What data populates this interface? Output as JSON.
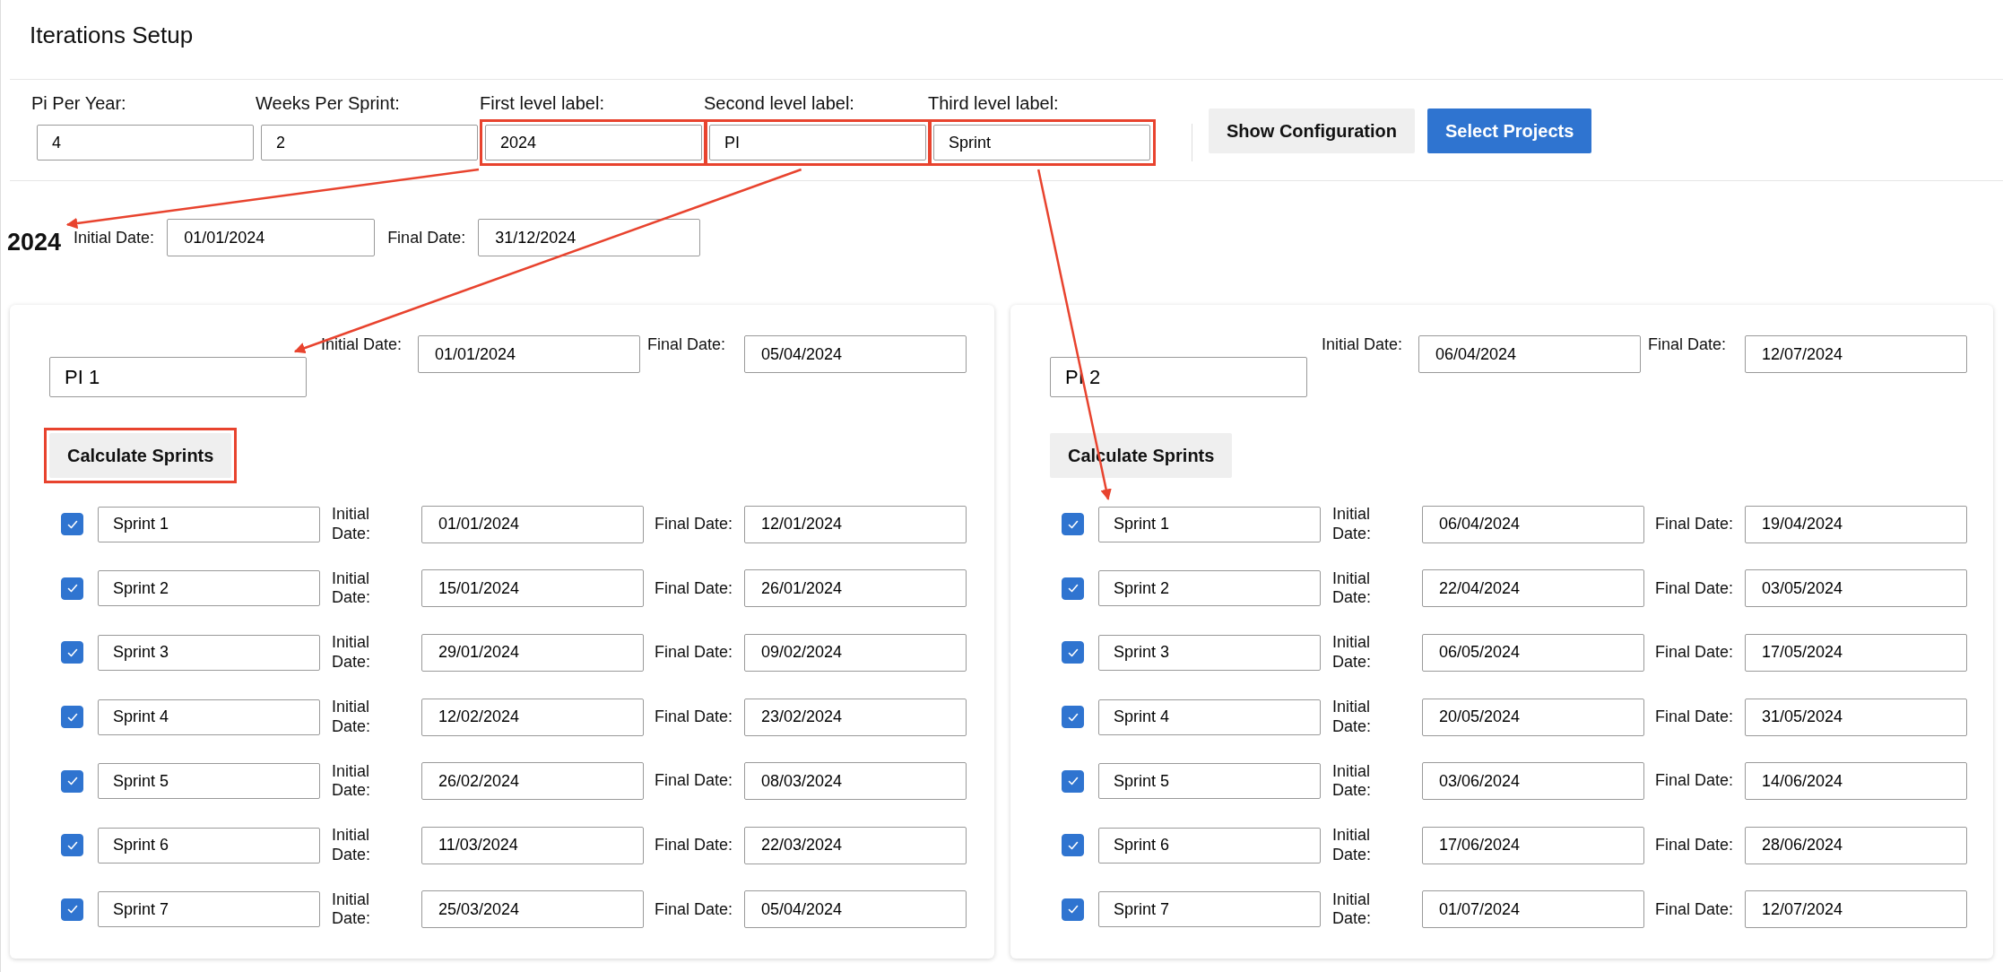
{
  "title": "Iterations Setup",
  "settings": [
    {
      "label": "Pi Per Year:",
      "value": "4",
      "highlighted": false
    },
    {
      "label": "Weeks Per Sprint:",
      "value": "2",
      "highlighted": false
    },
    {
      "label": "First level label:",
      "value": "2024",
      "highlighted": true
    },
    {
      "label": "Second level label:",
      "value": "PI",
      "highlighted": true
    },
    {
      "label": "Third level label:",
      "value": "Sprint",
      "highlighted": true
    }
  ],
  "buttons": [
    {
      "label": "Show Configuration",
      "kind": "secondary"
    },
    {
      "label": "Select Projects",
      "kind": "primary"
    }
  ],
  "year": {
    "heading": "2024",
    "initial_label": "Initial Date:",
    "initial_value": "01/01/2024",
    "final_label": "Final Date:",
    "final_value": "31/12/2024"
  },
  "pis": [
    {
      "name": "PI 1",
      "initial_label": "Initial Date:",
      "initial_value": "01/01/2024",
      "final_label": "Final Date:",
      "final_value": "05/04/2024",
      "calculate_button": {
        "label": "Calculate Sprints",
        "highlighted": true
      },
      "sprints": [
        {
          "checked": true,
          "name": "Sprint 1",
          "initial_label": "Initial Date:",
          "initial_value": "01/01/2024",
          "final_label": "Final Date:",
          "final_value": "12/01/2024"
        },
        {
          "checked": true,
          "name": "Sprint 2",
          "initial_label": "Initial Date:",
          "initial_value": "15/01/2024",
          "final_label": "Final Date:",
          "final_value": "26/01/2024"
        },
        {
          "checked": true,
          "name": "Sprint 3",
          "initial_label": "Initial Date:",
          "initial_value": "29/01/2024",
          "final_label": "Final Date:",
          "final_value": "09/02/2024"
        },
        {
          "checked": true,
          "name": "Sprint 4",
          "initial_label": "Initial Date:",
          "initial_value": "12/02/2024",
          "final_label": "Final Date:",
          "final_value": "23/02/2024"
        },
        {
          "checked": true,
          "name": "Sprint 5",
          "initial_label": "Initial Date:",
          "initial_value": "26/02/2024",
          "final_label": "Final Date:",
          "final_value": "08/03/2024"
        },
        {
          "checked": true,
          "name": "Sprint 6",
          "initial_label": "Initial Date:",
          "initial_value": "11/03/2024",
          "final_label": "Final Date:",
          "final_value": "22/03/2024"
        },
        {
          "checked": true,
          "name": "Sprint 7",
          "initial_label": "Initial Date:",
          "initial_value": "25/03/2024",
          "final_label": "Final Date:",
          "final_value": "05/04/2024"
        }
      ]
    },
    {
      "name": "PI 2",
      "initial_label": "Initial Date:",
      "initial_value": "06/04/2024",
      "final_label": "Final Date:",
      "final_value": "12/07/2024",
      "calculate_button": {
        "label": "Calculate Sprints",
        "highlighted": false
      },
      "sprints": [
        {
          "checked": true,
          "name": "Sprint 1",
          "initial_label": "Initial Date:",
          "initial_value": "06/04/2024",
          "final_label": "Final Date:",
          "final_value": "19/04/2024"
        },
        {
          "checked": true,
          "name": "Sprint 2",
          "initial_label": "Initial Date:",
          "initial_value": "22/04/2024",
          "final_label": "Final Date:",
          "final_value": "03/05/2024"
        },
        {
          "checked": true,
          "name": "Sprint 3",
          "initial_label": "Initial Date:",
          "initial_value": "06/05/2024",
          "final_label": "Final Date:",
          "final_value": "17/05/2024"
        },
        {
          "checked": true,
          "name": "Sprint 4",
          "initial_label": "Initial Date:",
          "initial_value": "20/05/2024",
          "final_label": "Final Date:",
          "final_value": "31/05/2024"
        },
        {
          "checked": true,
          "name": "Sprint 5",
          "initial_label": "Initial Date:",
          "initial_value": "03/06/2024",
          "final_label": "Final Date:",
          "final_value": "14/06/2024"
        },
        {
          "checked": true,
          "name": "Sprint 6",
          "initial_label": "Initial Date:",
          "initial_value": "17/06/2024",
          "final_label": "Final Date:",
          "final_value": "28/06/2024"
        },
        {
          "checked": true,
          "name": "Sprint 7",
          "initial_label": "Initial Date:",
          "initial_value": "01/07/2024",
          "final_label": "Final Date:",
          "final_value": "12/07/2024"
        }
      ]
    }
  ]
}
